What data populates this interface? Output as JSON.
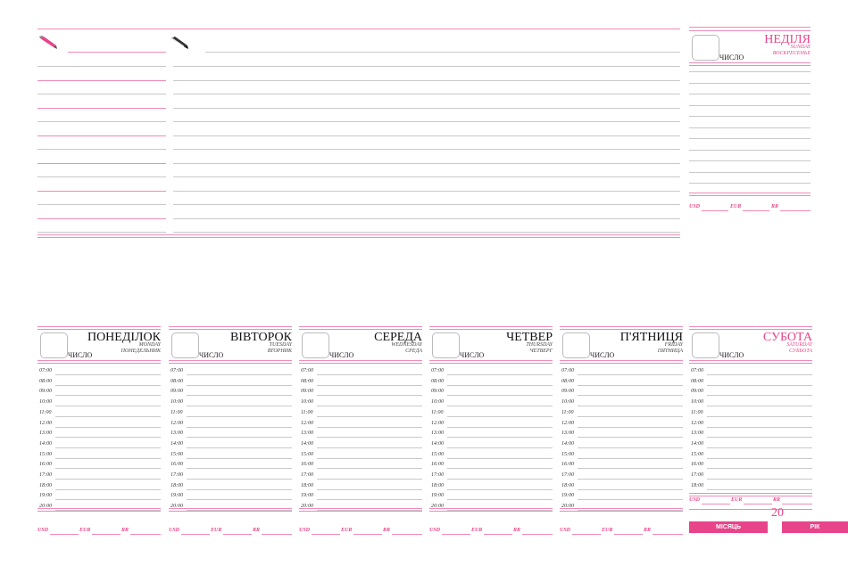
{
  "notes": {
    "pencil_icon": "pencil-icon",
    "marker_icon": "marker-icon"
  },
  "sunday": {
    "name": "НЕДІЛЯ",
    "en": "SUNDAY",
    "ru": "ВОСКРЕСЕНЬЕ",
    "date_label": "ЧИСЛО"
  },
  "days": [
    {
      "name": "ПОНЕДІЛОК",
      "en": "MONDAY",
      "ru": "ПОНЕДЕЛЬНИК",
      "date_label": "ЧИСЛО"
    },
    {
      "name": "ВІВТОРОК",
      "en": "TUESDAY",
      "ru": "ВТОРНИК",
      "date_label": "ЧИСЛО"
    },
    {
      "name": "СЕРЕДА",
      "en": "WEDNESDAY",
      "ru": "СРЕДА",
      "date_label": "ЧИСЛО"
    },
    {
      "name": "ЧЕТВЕР",
      "en": "THURSDAY",
      "ru": "ЧЕТВЕРГ",
      "date_label": "ЧИСЛО"
    },
    {
      "name": "П'ЯТНИЦЯ",
      "en": "FRIDAY",
      "ru": "ПЯТНИЦА",
      "date_label": "ЧИСЛО"
    },
    {
      "name": "СУБОТА",
      "en": "SATURDAY",
      "ru": "СУББОТА",
      "date_label": "ЧИСЛО"
    }
  ],
  "times": [
    "07:00",
    "08:00",
    "09:00",
    "10:00",
    "11:00",
    "12:00",
    "13:00",
    "14:00",
    "15:00",
    "16:00",
    "17:00",
    "18:00",
    "19:00",
    "20:00"
  ],
  "saturday_times": [
    "07:00",
    "08:00",
    "09:00",
    "10:00",
    "11:00",
    "12:00",
    "13:00",
    "14:00",
    "15:00",
    "16:00",
    "17:00",
    "18:00"
  ],
  "currency": {
    "usd": "USD",
    "eur": "EUR",
    "rr": "RR"
  },
  "footer": {
    "year_prefix": "20",
    "month_button": "МІСЯЦЬ",
    "year_button": "РІК"
  },
  "colors": {
    "accent": "#e8448a",
    "line": "#c9c9c9"
  }
}
